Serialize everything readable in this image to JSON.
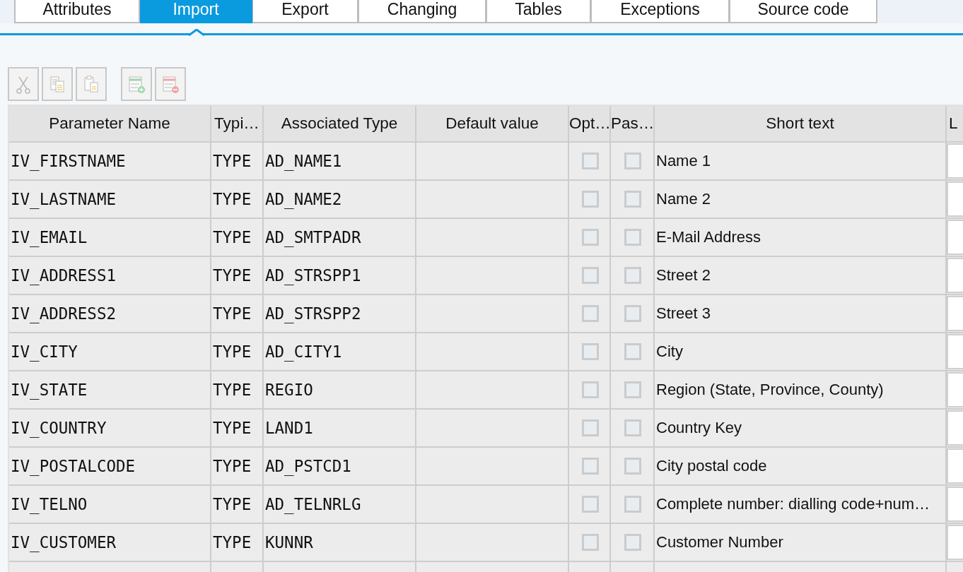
{
  "tabs": [
    {
      "label": "Attributes",
      "selected": false
    },
    {
      "label": "Import",
      "selected": true
    },
    {
      "label": "Export",
      "selected": false
    },
    {
      "label": "Changing",
      "selected": false
    },
    {
      "label": "Tables",
      "selected": false
    },
    {
      "label": "Exceptions",
      "selected": false
    },
    {
      "label": "Source code",
      "selected": false
    }
  ],
  "table": {
    "columns": [
      "Parameter Name",
      "Typi…",
      "Associated Type",
      "Default value",
      "Opt…",
      "Pas…",
      "Short text",
      "L"
    ],
    "rows": [
      {
        "name": "IV_FIRSTNAME",
        "typing": "TYPE",
        "type": "AD_NAME1",
        "optional": false,
        "pass_value": false,
        "short_text": "Name 1"
      },
      {
        "name": "IV_LASTNAME",
        "typing": "TYPE",
        "type": "AD_NAME2",
        "optional": false,
        "pass_value": false,
        "short_text": "Name 2"
      },
      {
        "name": "IV_EMAIL",
        "typing": "TYPE",
        "type": "AD_SMTPADR",
        "optional": false,
        "pass_value": false,
        "short_text": "E-Mail Address"
      },
      {
        "name": "IV_ADDRESS1",
        "typing": "TYPE",
        "type": "AD_STRSPP1",
        "optional": false,
        "pass_value": false,
        "short_text": "Street 2"
      },
      {
        "name": "IV_ADDRESS2",
        "typing": "TYPE",
        "type": "AD_STRSPP2",
        "optional": false,
        "pass_value": false,
        "short_text": "Street 3"
      },
      {
        "name": "IV_CITY",
        "typing": "TYPE",
        "type": "AD_CITY1",
        "optional": false,
        "pass_value": false,
        "short_text": "City"
      },
      {
        "name": "IV_STATE",
        "typing": "TYPE",
        "type": "REGIO",
        "optional": false,
        "pass_value": false,
        "short_text": "Region (State, Province, County)"
      },
      {
        "name": "IV_COUNTRY",
        "typing": "TYPE",
        "type": "LAND1",
        "optional": false,
        "pass_value": false,
        "short_text": "Country Key"
      },
      {
        "name": "IV_POSTALCODE",
        "typing": "TYPE",
        "type": "AD_PSTCD1",
        "optional": false,
        "pass_value": false,
        "short_text": "City postal code"
      },
      {
        "name": "IV_TELNO",
        "typing": "TYPE",
        "type": "AD_TELNRLG",
        "optional": false,
        "pass_value": false,
        "short_text": "Complete number: dialling code+num…"
      },
      {
        "name": "IV_CUSTOMER",
        "typing": "TYPE",
        "type": "KUNNR",
        "optional": false,
        "pass_value": false,
        "short_text": "Customer Number"
      }
    ]
  }
}
